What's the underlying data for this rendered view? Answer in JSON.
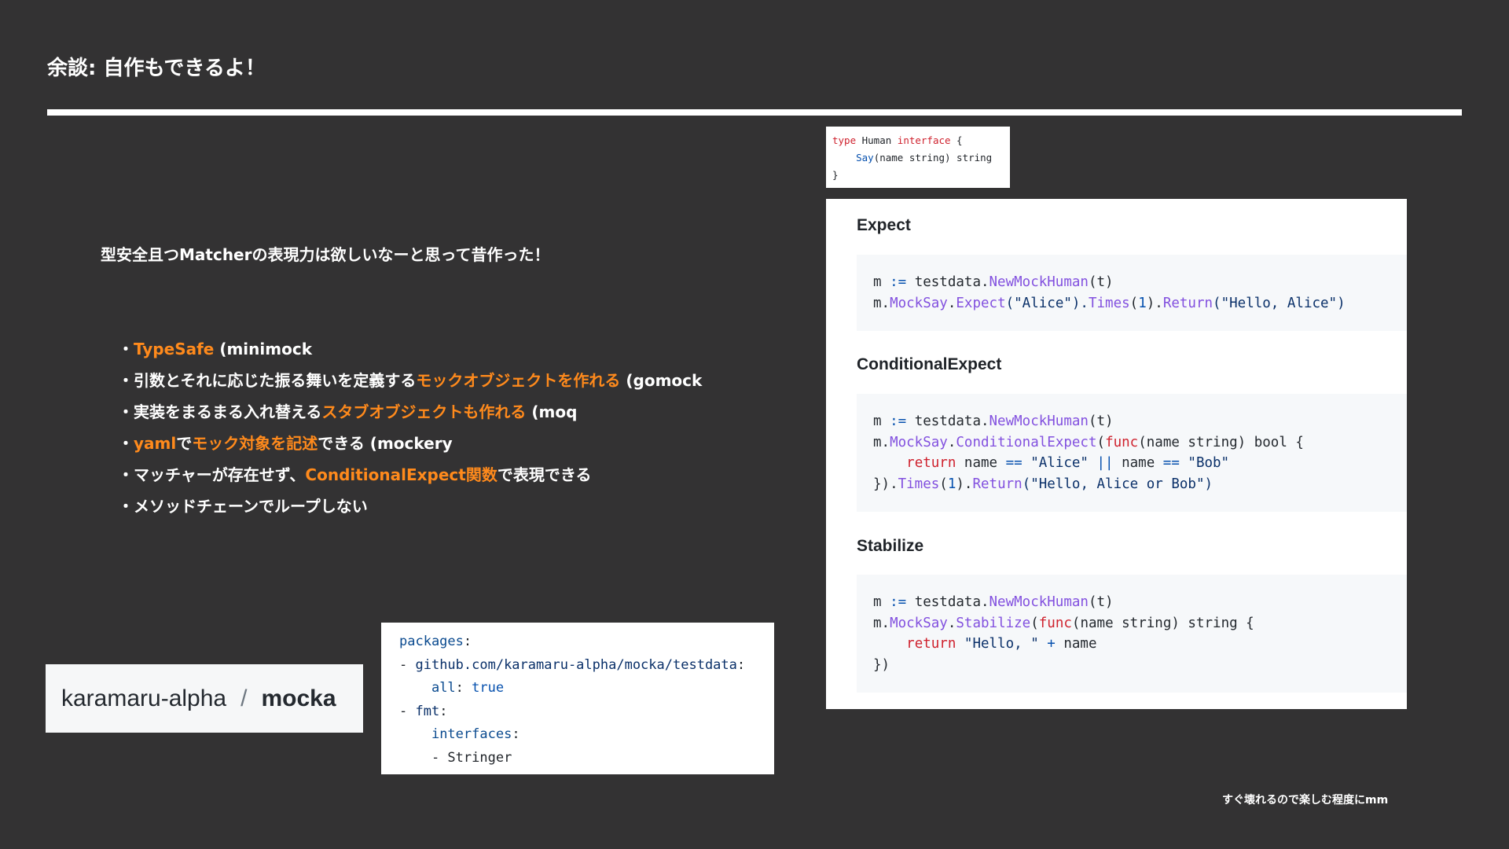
{
  "slide": {
    "title": "余談: 自作もできるよ！",
    "lead": "型安全且つMatcherの表現力は欲しいなーと思って昔作った！",
    "footnote": "すぐ壊れるので楽しむ程度にmm"
  },
  "bullets": [
    {
      "hl": "TypeSafe",
      "after": " (minimock"
    },
    {
      "before": "引数とそれに応じた振る舞いを定義する",
      "hl": "モックオブジェクトを作れる",
      "after": " (gomock"
    },
    {
      "before": "実装をまるまる入れ替える",
      "hl": "スタブオブジェクトも作れる",
      "after": " (moq"
    },
    {
      "hl1": "yaml",
      "mid1": "で",
      "hl2": "モック対象を記述",
      "after": "できる (mockery"
    },
    {
      "before": "マッチャーが存在せず、",
      "hl": "ConditionalExpect関数",
      "after": "で表現できる"
    },
    {
      "before": "メソッドチェーンでループしない"
    }
  ],
  "repo": {
    "owner": "karamaru-alpha",
    "separator": "/",
    "name": "mocka"
  },
  "yaml": {
    "packages": "packages",
    "pkg1": "github.com/karamaru-alpha/mocka/testdata",
    "all_key": "all",
    "all_val": "true",
    "pkg2": "fmt",
    "interfaces": "interfaces",
    "item": "Stringer"
  },
  "interface_code": {
    "type_kw": "type",
    "name": " Human ",
    "iface_kw": "interface",
    "open": " {",
    "method": "Say",
    "sig": "(name string) string",
    "close": "}"
  },
  "sections": {
    "expect": {
      "title": "Expect",
      "l1a": "m ",
      "l1op": ":=",
      "l1b": " testdata.",
      "l1fn": "NewMockHuman",
      "l1c": "(t)",
      "l2a": "m.",
      "l2m1": "MockSay",
      "l2d": ".",
      "l2m2": "Expect",
      "l2s": "(\"Alice\").",
      "l2m3": "Times",
      "l2p": "(",
      "l2n": "1",
      "l2q": ").",
      "l2m4": "Return",
      "l2r": "(\"Hello, Alice\")"
    },
    "conditional": {
      "title": "ConditionalExpect",
      "l1a": "m ",
      "l1op": ":=",
      "l1b": " testdata.",
      "l1fn": "NewMockHuman",
      "l1c": "(t)",
      "l2a": "m.",
      "l2m1": "MockSay",
      "l2d": ".",
      "l2m2": "ConditionalExpect",
      "l2p": "(",
      "l2kw": "func",
      "l2r": "(name string) bool {",
      "l3kw": "return",
      "l3a": " name ",
      "l3op1": "==",
      "l3s1": " \"Alice\" ",
      "l3op2": "||",
      "l3b": " name ",
      "l3op3": "==",
      "l3s2": " \"Bob\"",
      "l4a": "}).",
      "l4m1": "Times",
      "l4p": "(",
      "l4n": "1",
      "l4q": ").",
      "l4m2": "Return",
      "l4r": "(\"Hello, Alice or Bob\")"
    },
    "stabilize": {
      "title": "Stabilize",
      "l1a": "m ",
      "l1op": ":=",
      "l1b": " testdata.",
      "l1fn": "NewMockHuman",
      "l1c": "(t)",
      "l2a": "m.",
      "l2m1": "MockSay",
      "l2d": ".",
      "l2m2": "Stabilize",
      "l2p": "(",
      "l2kw": "func",
      "l2r": "(name string) string {",
      "l3kw": "return",
      "l3s": " \"Hello, \" ",
      "l3op": "+",
      "l3b": " name",
      "l4": "})"
    }
  }
}
